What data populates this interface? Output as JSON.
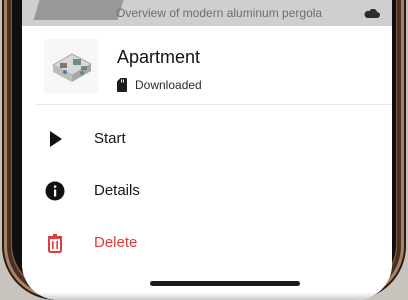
{
  "background_item": {
    "text": "Overview of modern aluminum pergola",
    "icon": "cloud-icon"
  },
  "file": {
    "title": "Apartment",
    "status": "Downloaded",
    "thumbnail_icon": "apartment-3d-thumbnail",
    "status_icon": "device-storage-icon"
  },
  "menu": {
    "items": [
      {
        "label": "Start",
        "icon": "play-icon"
      },
      {
        "label": "Details",
        "icon": "info-icon"
      },
      {
        "label": "Delete",
        "icon": "trash-icon"
      }
    ]
  },
  "colors": {
    "danger": "#e23a3a",
    "text": "#161616",
    "muted": "#6e6e6e",
    "surface": "#ffffff",
    "frame": "#7a5a45"
  }
}
